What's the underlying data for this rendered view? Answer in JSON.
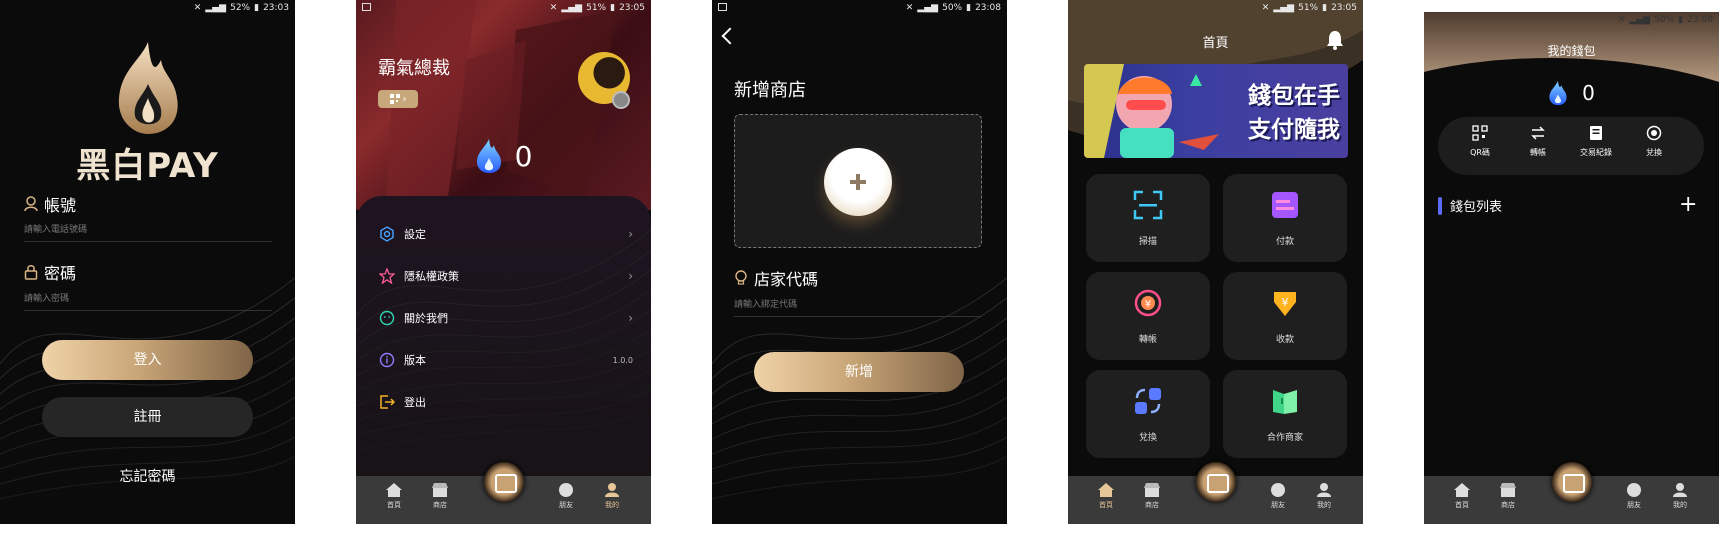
{
  "screen1": {
    "status": {
      "battery": "52%",
      "time": "23:03"
    },
    "brand": "黑白PAY",
    "account_label": "帳號",
    "account_placeholder": "請輸入電話號碼",
    "password_label": "密碼",
    "password_placeholder": "請輸入密碼",
    "login_button": "登入",
    "register_button": "註冊",
    "forgot_link": "忘記密碼"
  },
  "screen2": {
    "status": {
      "battery": "51%",
      "time": "23:05"
    },
    "username": "霸氣總裁",
    "balance": "0",
    "menu": [
      {
        "label": "設定",
        "icon": "settings-icon",
        "right": ""
      },
      {
        "label": "隱私權政策",
        "icon": "star-icon",
        "right": ""
      },
      {
        "label": "關於我們",
        "icon": "smile-icon",
        "right": ""
      },
      {
        "label": "版本",
        "icon": "info-icon",
        "right": "1.0.0"
      },
      {
        "label": "登出",
        "icon": "logout-icon",
        "right": ""
      }
    ],
    "tabs": [
      "首頁",
      "商店",
      "朋友",
      "我的"
    ]
  },
  "screen3": {
    "status": {
      "battery": "50%",
      "time": "23:08"
    },
    "title": "新增商店",
    "code_label": "店家代碼",
    "code_placeholder": "請輸入綁定代碼",
    "submit_button": "新增"
  },
  "screen4": {
    "status": {
      "battery": "51%",
      "time": "23:05"
    },
    "title": "首頁",
    "banner_line1": "錢包在手",
    "banner_line2": "支付隨我",
    "tiles": [
      "掃描",
      "付款",
      "轉帳",
      "收款",
      "兌換",
      "合作商家"
    ],
    "tabs": [
      "首頁",
      "商店",
      "朋友",
      "我的"
    ]
  },
  "screen5": {
    "status": {
      "battery": "50%",
      "time": "23:08"
    },
    "title": "我的錢包",
    "balance": "0",
    "actions": [
      "QR碼",
      "轉帳",
      "交易紀錄",
      "兌換"
    ],
    "list_title": "錢包列表",
    "tabs": [
      "首頁",
      "商店",
      "朋友",
      "我的"
    ]
  }
}
